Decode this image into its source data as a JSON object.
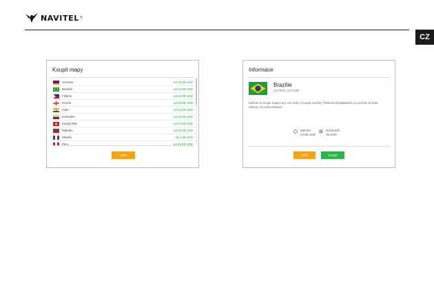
{
  "header": {
    "brand": "NAVITEL",
    "reg_mark": "®",
    "lang_tab": "CZ"
  },
  "buy_maps": {
    "title": "Koupit mapy",
    "countries": [
      {
        "name": "Arménie",
        "price": "od 10,99 USD",
        "flag": "armenia"
      },
      {
        "name": "Brazílie",
        "price": "od 14,99 USD",
        "flag": "brazil"
      },
      {
        "name": "Filipíny",
        "price": "od 10,99 USD",
        "flag": "philippines"
      },
      {
        "name": "Gruzie",
        "price": "od 10,99 USD",
        "flag": "georgia"
      },
      {
        "name": "Indie",
        "price": "od 22,99 USD",
        "flag": "india"
      },
      {
        "name": "Kolumbie",
        "price": "od 10,99 USD",
        "flag": "colombia"
      },
      {
        "name": "Kyrgyzstán",
        "price": "od 12,99 USD",
        "flag": "kyrgyzstan"
      },
      {
        "name": "Malediv",
        "price": "od 10,99 USD",
        "flag": "maldives"
      },
      {
        "name": "Mexiko",
        "price": "od 1,99 USD",
        "flag": "mexico"
      },
      {
        "name": "Peru",
        "price": "od 14,99 USD",
        "flag": "peru"
      }
    ],
    "button": "Zpět"
  },
  "info": {
    "title": "Informace",
    "country": "Brazílie",
    "version": "Q4 MOD (120 MB)",
    "description": "Můžete si koupit mapu na 1 rok nebo ji koupit navždy. Platnost předplatného se počítá od data nákupu na webu Navitel.",
    "options": [
      {
        "label": "365 dní",
        "price": "14,99 USD",
        "checked": false
      },
      {
        "label": "Doživotně",
        "price": "30 USD",
        "checked": true
      }
    ],
    "back_button": "Zpět",
    "buy_button": "Koupit"
  },
  "colors": {
    "accent_orange": "#f5a316",
    "accent_green": "#2cb34a",
    "price_green": "#22a53d",
    "header_dark": "#1c1c1c"
  }
}
